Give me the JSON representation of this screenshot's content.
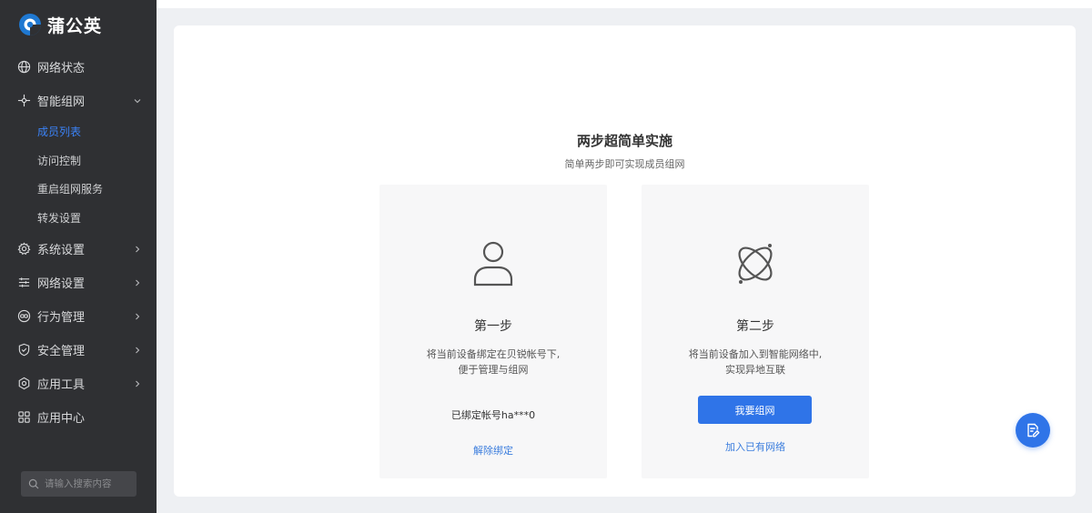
{
  "brand": {
    "name": "蒲公英",
    "color": "#1f78d1"
  },
  "sidebar": {
    "items": [
      {
        "label": "网络状态",
        "icon": "globe-icon",
        "chevron": "none"
      },
      {
        "label": "智能组网",
        "icon": "network-icon",
        "chevron": "down",
        "children": [
          {
            "label": "成员列表",
            "active": true
          },
          {
            "label": "访问控制",
            "active": false
          },
          {
            "label": "重启组网服务",
            "active": false
          },
          {
            "label": "转发设置",
            "active": false
          }
        ]
      },
      {
        "label": "系统设置",
        "icon": "gear-icon",
        "chevron": "right"
      },
      {
        "label": "网络设置",
        "icon": "sliders-icon",
        "chevron": "right"
      },
      {
        "label": "行为管理",
        "icon": "link-icon",
        "chevron": "right"
      },
      {
        "label": "安全管理",
        "icon": "shield-icon",
        "chevron": "right"
      },
      {
        "label": "应用工具",
        "icon": "tool-icon",
        "chevron": "right"
      },
      {
        "label": "应用中心",
        "icon": "grid-icon",
        "chevron": "none"
      }
    ],
    "search": {
      "placeholder": "请输入搜索内容"
    }
  },
  "main": {
    "title": "两步超简单实施",
    "subtitle": "简单两步即可实现成员组网",
    "steps": [
      {
        "title": "第一步",
        "desc_line1": "将当前设备绑定在贝锐帐号下,",
        "desc_line2": "便于管理与组网",
        "bound_account": "已绑定帐号ha***0",
        "link": "解除绑定",
        "icon": "user-icon"
      },
      {
        "title": "第二步",
        "desc_line1": "将当前设备加入到智能网络中,",
        "desc_line2": "实现异地互联",
        "button": "我要组网",
        "link": "加入已有网络",
        "icon": "orbit-icon"
      }
    ],
    "fab_icon": "document-edit-icon"
  },
  "colors": {
    "sidebar_bg": "#2f3033",
    "accent": "#2f74e8",
    "active_text": "#3b82f6",
    "link": "#3b7ddd"
  }
}
